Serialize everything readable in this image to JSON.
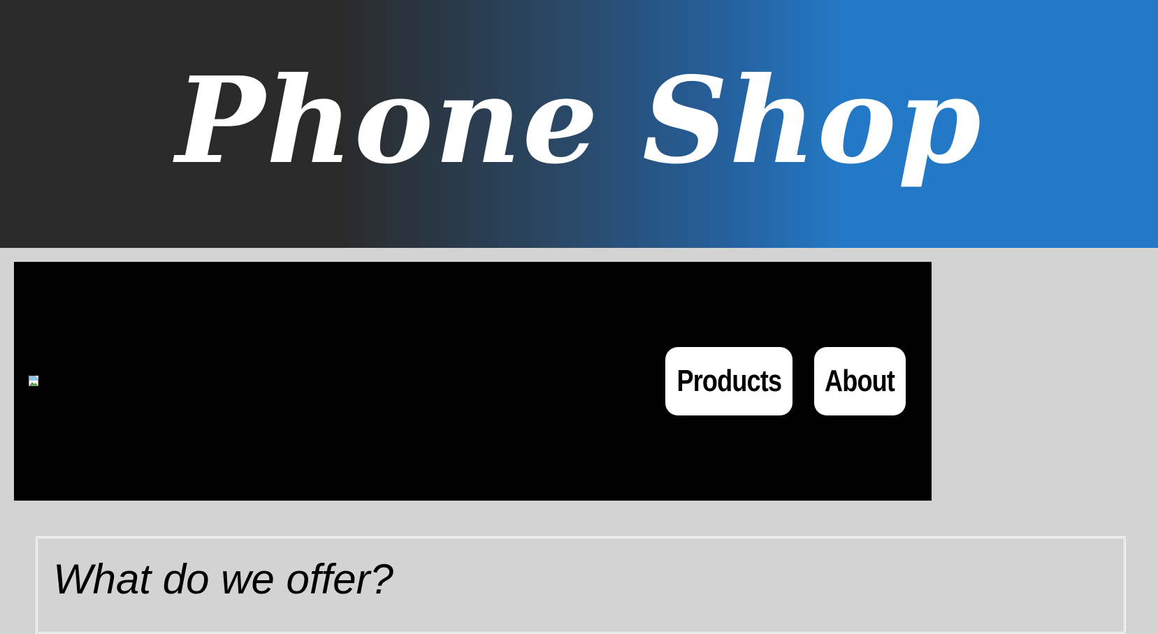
{
  "header": {
    "title": "Phone Shop"
  },
  "nav": {
    "logo_icon": "broken-image-icon",
    "items": [
      {
        "label": "Products"
      },
      {
        "label": "About"
      }
    ]
  },
  "main": {
    "section_heading": "What do we offer?"
  },
  "colors": {
    "banner_dark": "#2a2a2a",
    "banner_blue": "#2479c7",
    "page_background": "#d3d3d3",
    "nav_background": "#000000",
    "button_background": "#ffffff"
  }
}
